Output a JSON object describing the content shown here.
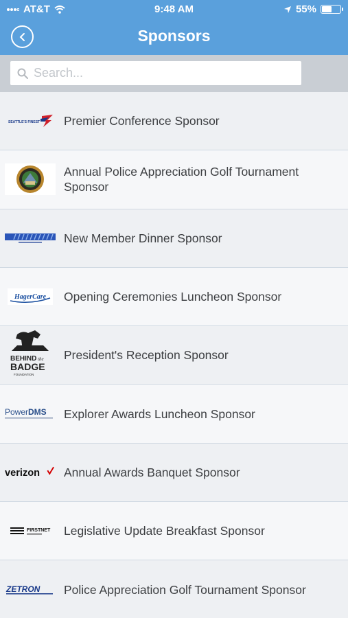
{
  "status": {
    "carrier": "AT&T",
    "time": "9:48 AM",
    "battery": "55%",
    "battery_level": 0.55
  },
  "nav": {
    "title": "Sponsors",
    "back_icon": "chevron-left-icon"
  },
  "search": {
    "placeholder": "Search..."
  },
  "sponsors": [
    {
      "label": "Premier Conference Sponsor",
      "logo": "seattles-finest-logo",
      "logo_text": "SEATTLE'S FINEST"
    },
    {
      "label": "Annual Police Appreciation Golf Tournament Sponsor",
      "logo": "police-seal-logo"
    },
    {
      "label": "New Member Dinner Sponsor",
      "logo": "blue-banner-logo"
    },
    {
      "label": "Opening Ceremonies Luncheon Sponsor",
      "logo": "hagercare-logo",
      "logo_text": "HagerCare"
    },
    {
      "label": "President's Reception Sponsor",
      "logo": "behind-the-badge-logo",
      "logo_text": "BEHIND the BADGE FOUNDATION"
    },
    {
      "label": "Explorer Awards Luncheon Sponsor",
      "logo": "powerdms-logo",
      "logo_text": "PowerDMS"
    },
    {
      "label": "Annual Awards Banquet Sponsor",
      "logo": "verizon-logo",
      "logo_text": "verizon"
    },
    {
      "label": "Legislative Update Breakfast Sponsor",
      "logo": "firstnet-logo",
      "logo_text": "FIRSTNET"
    },
    {
      "label": "Police Appreciation Golf Tournament Sponsor",
      "logo": "zetron-logo",
      "logo_text": "ZETRON"
    }
  ],
  "colors": {
    "header": "#5aa0dc",
    "search_bg": "#c9ced4",
    "text": "#3d3f42"
  }
}
